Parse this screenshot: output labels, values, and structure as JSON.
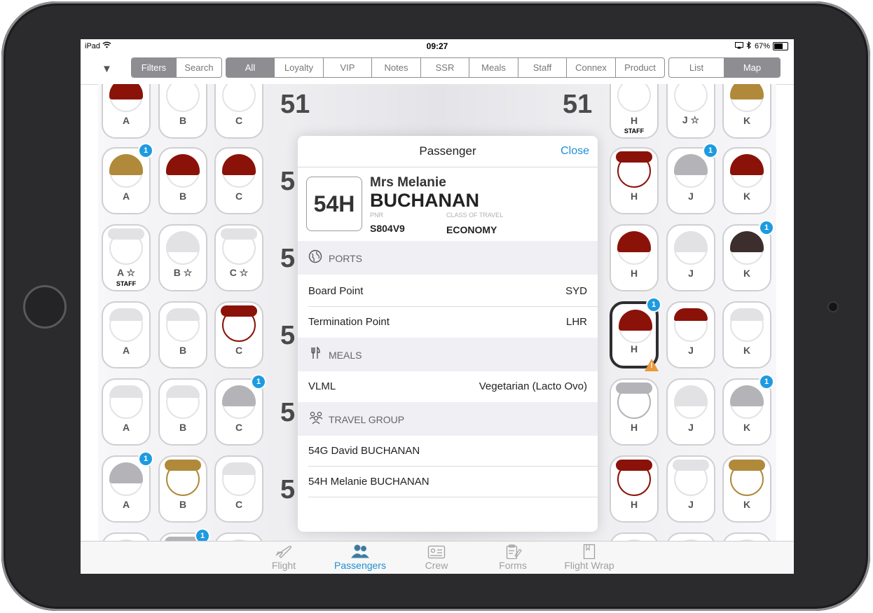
{
  "status": {
    "device": "iPad",
    "time": "09:27",
    "battery": "67%"
  },
  "toolbar": {
    "left_seg": [
      "Filters",
      "Search"
    ],
    "filter_seg": [
      "All",
      "Loyalty",
      "VIP",
      "Notes",
      "SSR",
      "Meals",
      "Staff",
      "Connex",
      "Product"
    ],
    "view_seg": [
      "List",
      "Map"
    ]
  },
  "rows": [
    "51",
    "51",
    "5",
    "5",
    "5",
    "5",
    "5"
  ],
  "seat_letters": {
    "a": "A",
    "b": "B",
    "c": "C",
    "h": "H",
    "j": "J",
    "k": "K"
  },
  "seat_subtext": {
    "staff": "STAFF",
    "star": "☆"
  },
  "badge_count": "1",
  "panel": {
    "title": "Passenger",
    "close": "Close",
    "seat": "54H",
    "salutation": "Mrs Melanie",
    "surname": "BUCHANAN",
    "pnr_label": "PNR",
    "pnr": "S804V9",
    "class_label": "CLASS OF TRAVEL",
    "class": "ECONOMY",
    "sections": {
      "ports": {
        "title": "PORTS",
        "rows": [
          {
            "k": "Board Point",
            "v": "SYD"
          },
          {
            "k": "Termination Point",
            "v": "LHR"
          }
        ]
      },
      "meals": {
        "title": "MEALS",
        "rows": [
          {
            "k": "VLML",
            "v": "Vegetarian (Lacto Ovo)"
          }
        ]
      },
      "group": {
        "title": "TRAVEL GROUP",
        "rows": [
          {
            "k": "54G David BUCHANAN"
          },
          {
            "k": "54H Melanie BUCHANAN"
          }
        ]
      }
    }
  },
  "tabs": [
    {
      "label": "Flight",
      "icon": "plane-icon"
    },
    {
      "label": "Passengers",
      "icon": "people-icon"
    },
    {
      "label": "Crew",
      "icon": "id-card-icon"
    },
    {
      "label": "Forms",
      "icon": "clipboard-icon"
    },
    {
      "label": "Flight Wrap",
      "icon": "folder-icon"
    }
  ],
  "colors": {
    "accent": "#1e8fd6",
    "hair_red": "#8b1208",
    "hair_gold": "#b08a3a",
    "hair_dark": "#3c2e2c",
    "hair_grey": "#b4b4b8",
    "hair_light": "#e2e2e5",
    "badge": "#1e9be0",
    "warning": "#e8993a"
  }
}
